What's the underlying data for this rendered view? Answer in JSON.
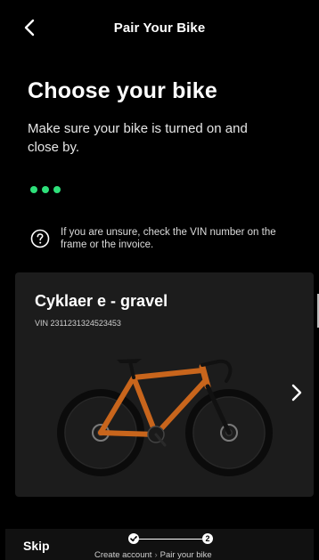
{
  "header": {
    "title": "Pair Your Bike",
    "back_icon": "chevron-left-icon"
  },
  "main": {
    "title": "Choose your bike",
    "subtitle": "Make sure your bike is turned on and close by.",
    "loading_color": "#2ee07a",
    "hint": {
      "icon": "question-circle-icon",
      "text": "If you are unsure, check the VIN number on the frame or the invoice."
    }
  },
  "bike_card": {
    "name": "Cyklaer e - gravel",
    "vin": "VIN 2311231324523453",
    "next_icon": "chevron-right-icon",
    "frame_color": "#c8651c"
  },
  "footer": {
    "skip_label": "Skip",
    "steps": [
      {
        "label": "Create account",
        "status": "done",
        "marker_icon": "check-icon"
      },
      {
        "label": "Pair your bike",
        "status": "current",
        "marker": "2"
      }
    ],
    "step_separator": "›"
  }
}
